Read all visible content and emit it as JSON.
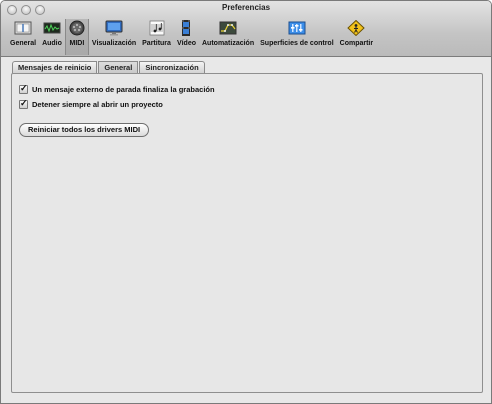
{
  "window": {
    "title": "Preferencias"
  },
  "toolbar": {
    "items": [
      {
        "label": "General",
        "icon": "general-icon",
        "selected": false
      },
      {
        "label": "Audio",
        "icon": "audio-icon",
        "selected": false
      },
      {
        "label": "MIDI",
        "icon": "midi-icon",
        "selected": true
      },
      {
        "label": "Visualización",
        "icon": "display-icon",
        "selected": false
      },
      {
        "label": "Partitura",
        "icon": "score-icon",
        "selected": false
      },
      {
        "label": "Vídeo",
        "icon": "video-icon",
        "selected": false
      },
      {
        "label": "Automatización",
        "icon": "automation-icon",
        "selected": false
      },
      {
        "label": "Superficies de control",
        "icon": "control-surfaces-icon",
        "selected": false
      },
      {
        "label": "Compartir",
        "icon": "share-icon",
        "selected": false
      }
    ]
  },
  "tabs": [
    {
      "label": "Mensajes de reinicio",
      "active": false
    },
    {
      "label": "General",
      "active": true
    },
    {
      "label": "Sincronización",
      "active": false
    }
  ],
  "general": {
    "stop_message_label": "Un mensaje externo de parada finaliza la grabación",
    "stop_message_checked": true,
    "always_stop_label": "Detener siempre al abrir un proyecto",
    "always_stop_checked": true,
    "reset_button_label": "Reiniciar todos los drivers MIDI"
  },
  "colors": {
    "window_bg": "#e8e8e8",
    "toolbar_selected": "#acacac",
    "score_icon": "#222222",
    "video_icon": "#3a7fd6",
    "surfaces_icon": "#3b8de8",
    "share_icon": "#f2c21b",
    "audio_icon": "#2f8a3a"
  }
}
